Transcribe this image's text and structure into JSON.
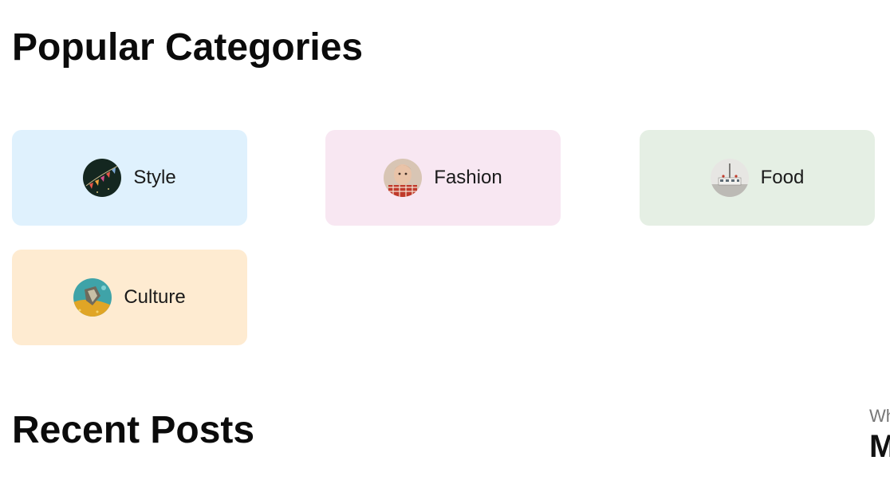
{
  "popular": {
    "title": "Popular Categories",
    "categories": [
      {
        "label": "Style",
        "bg": "#dff1fd",
        "icon": "style-thumbnail"
      },
      {
        "label": "Fashion",
        "bg": "#f8e7f2",
        "icon": "fashion-thumbnail"
      },
      {
        "label": "Food",
        "bg": "#e5efe4",
        "icon": "food-thumbnail"
      },
      {
        "label": "Culture",
        "bg": "#feebd1",
        "icon": "culture-thumbnail"
      }
    ]
  },
  "recent": {
    "title": "Recent Posts"
  },
  "side": {
    "kicker": "Wh",
    "heading": "M"
  }
}
